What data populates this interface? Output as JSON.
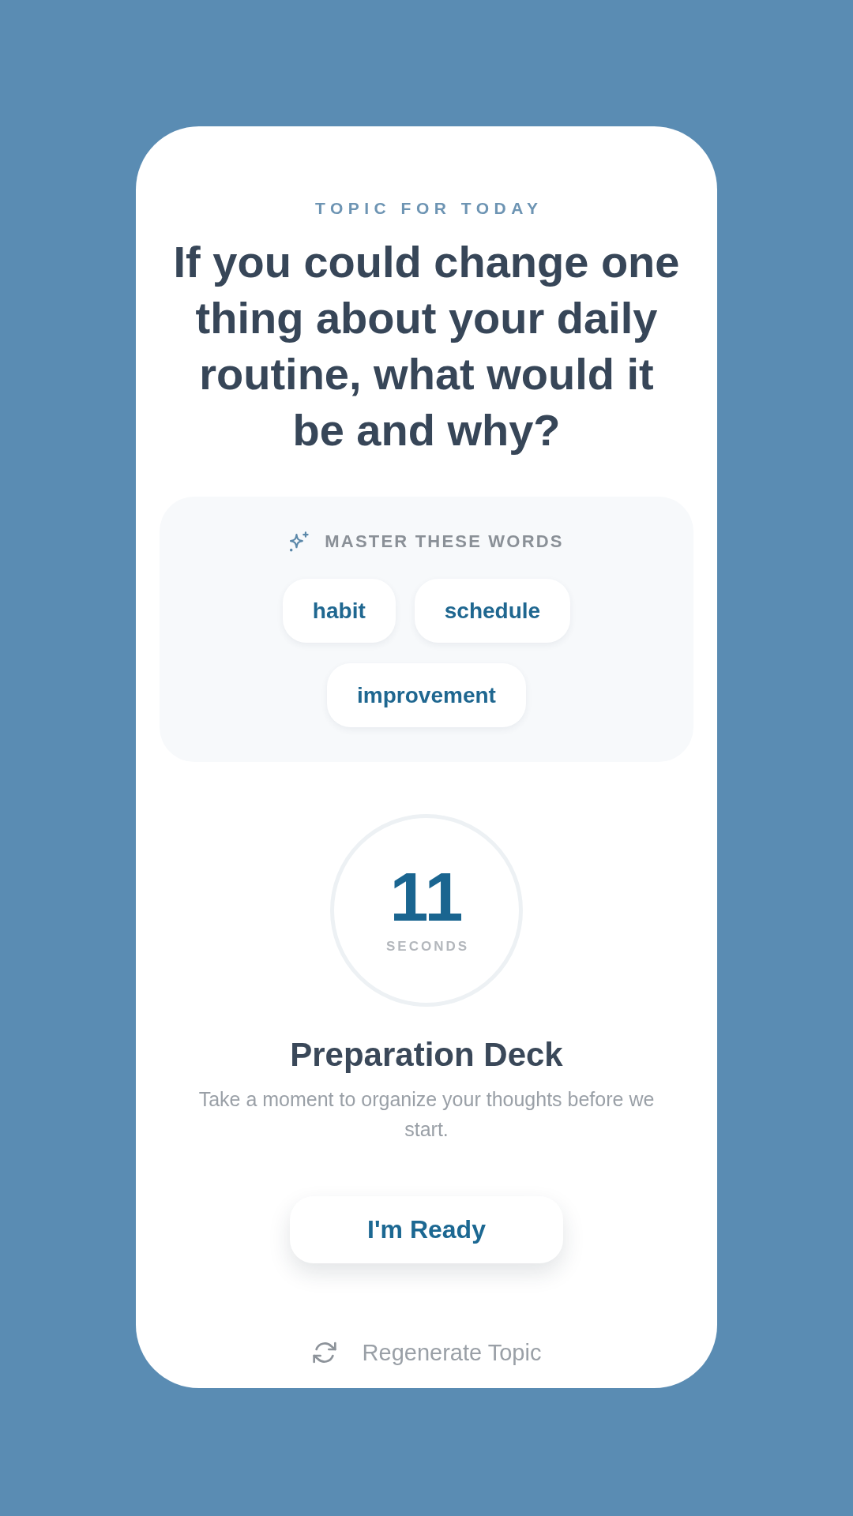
{
  "topic": {
    "label": "TOPIC FOR TODAY",
    "question": "If you could change one thing about your daily routine, what would it be and why?"
  },
  "vocabulary": {
    "title": "MASTER THESE WORDS",
    "words": [
      "habit",
      "schedule",
      "improvement"
    ]
  },
  "timer": {
    "value": "11",
    "unit": "SECONDS"
  },
  "preparation": {
    "title": "Preparation Deck",
    "description": "Take a moment to organize your thoughts before we start."
  },
  "actions": {
    "ready_button": "I'm Ready",
    "regenerate_link": "Regenerate Topic"
  }
}
